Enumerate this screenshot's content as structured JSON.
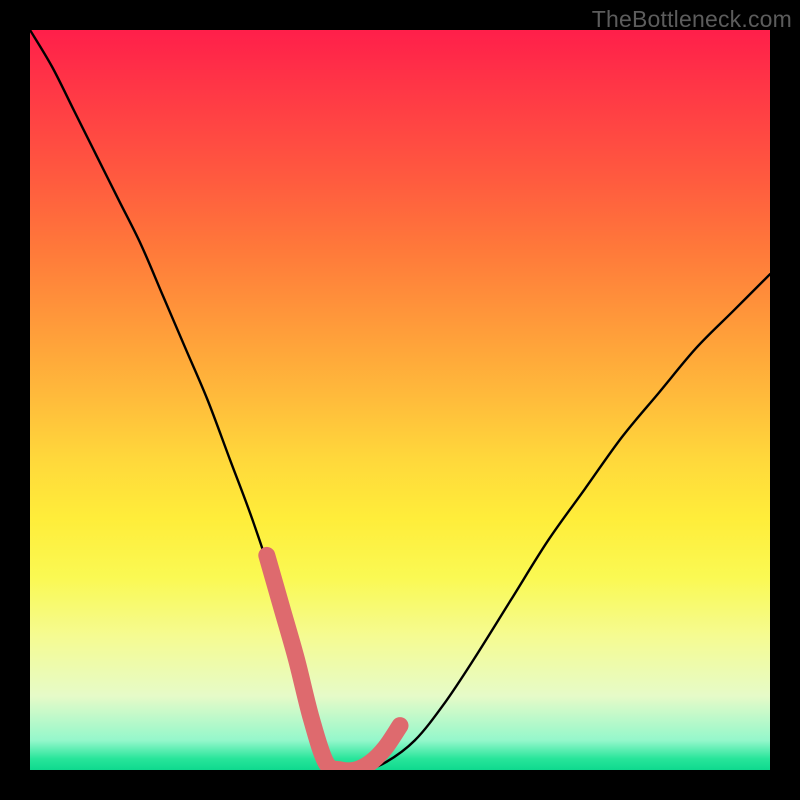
{
  "watermark": "TheBottleneck.com",
  "chart_data": {
    "type": "line",
    "title": "",
    "xlabel": "",
    "ylabel": "",
    "xlim": [
      0,
      100
    ],
    "ylim": [
      0,
      100
    ],
    "series": [
      {
        "name": "bottleneck-curve",
        "x": [
          0,
          3,
          6,
          9,
          12,
          15,
          18,
          21,
          24,
          27,
          30,
          33,
          36,
          38,
          40,
          42,
          45,
          48,
          52,
          56,
          60,
          65,
          70,
          75,
          80,
          85,
          90,
          95,
          100
        ],
        "y": [
          100,
          95,
          89,
          83,
          77,
          71,
          64,
          57,
          50,
          42,
          34,
          25,
          15,
          7,
          1,
          0,
          0,
          1,
          4,
          9,
          15,
          23,
          31,
          38,
          45,
          51,
          57,
          62,
          67
        ]
      },
      {
        "name": "highlight-band",
        "x": [
          32,
          34,
          36,
          38,
          40,
          42,
          44,
          46,
          48,
          50
        ],
        "y": [
          29,
          22,
          15,
          7,
          1,
          0,
          0,
          1,
          3,
          6
        ]
      }
    ]
  }
}
